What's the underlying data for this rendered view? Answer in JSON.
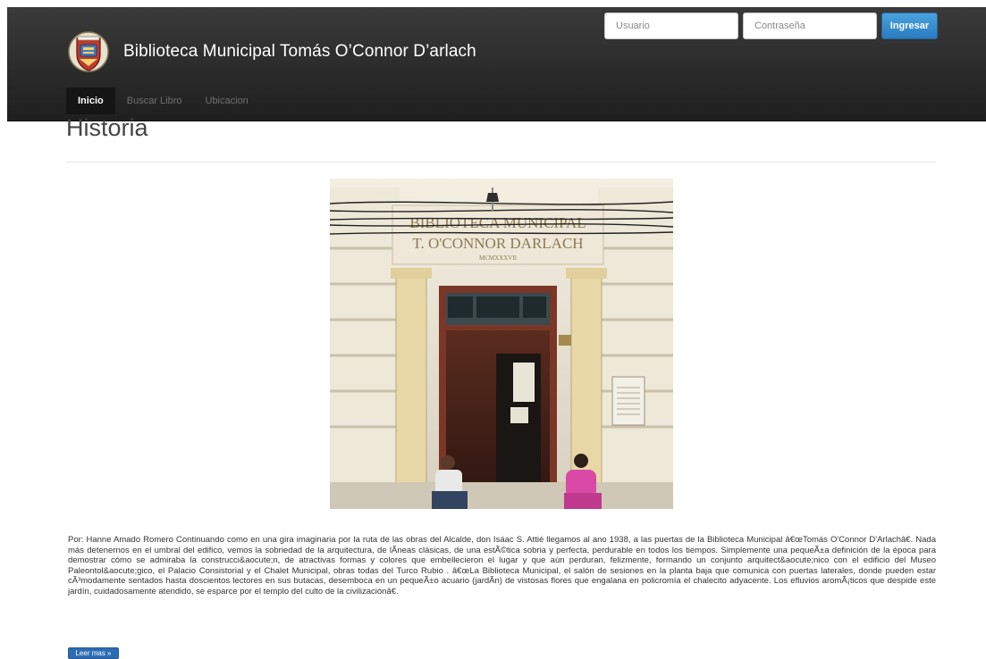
{
  "header": {
    "site_title": "Biblioteca Municipal Tomás O’Connor D’arlach",
    "logo_icon": "municipal-crest-icon"
  },
  "nav": {
    "items": [
      {
        "label": "Inicio",
        "active": true
      },
      {
        "label": "Buscar Libro",
        "active": false
      },
      {
        "label": "Ubicacion",
        "active": false
      }
    ]
  },
  "login": {
    "username_placeholder": "Usuario",
    "password_placeholder": "Contraseña",
    "submit_label": "Ingresar"
  },
  "main": {
    "title": "Historia",
    "building_sign_line1": "BIBLIOTECA MUNICIPAL",
    "building_sign_line2": "T. O'CONNOR DARLACH",
    "building_sign_line3": "MCMXXXVII",
    "article_text": "Por: Hanne Amado Romero Continuando como en una gira imaginaria por la ruta de las obras del Alcalde, don Isáac S. Attié llegamos al ano 1938, a las puertas de la Biblioteca Municipal â€œTomás O'Connor D'Arlachâ€. Nada más detenernos en el umbral del edifico, vemos la sobriedad de la arquitectura, de lÃneas clásicas, de una estÃ©tica sobria y perfecta, perdurable en todos los tiempos. Simplemente una pequeÃ±a definición de la época para demostrar cómo se admiraba la construcci&aocute;n, de atractivas formas y colores que embellecieron el lugar y que aún perduran, felizmente, formando un conjunto arquitect&aocute;nico con el edificio del Museo Paleontol&aocute;gico, el Palacio Consistorial y el Chalet Municipal, obras todas del Turco Rubio . â€œLa Biblioteca Municipal, el salón de sesiones en la planta baja que comunica con puertas laterales, donde pueden estar cÃ³modamente sentados hasta doscientos lectores en sus butacas, desemboca en un pequeÃ±o acuario (jardÃn) de vistosas flores que engalana en policromía el chalecito adyacente. Los efluvios aromÃ¡ticos que despide este jardín, cuidadosamente atendido, se esparce por el templo del culto de la civilizaciónâ€.",
    "read_more_label": "Leer mas »"
  },
  "colors": {
    "navbar": "#2a2a2a",
    "primary_button": "#2a7ac0",
    "title_text": "#444444"
  }
}
